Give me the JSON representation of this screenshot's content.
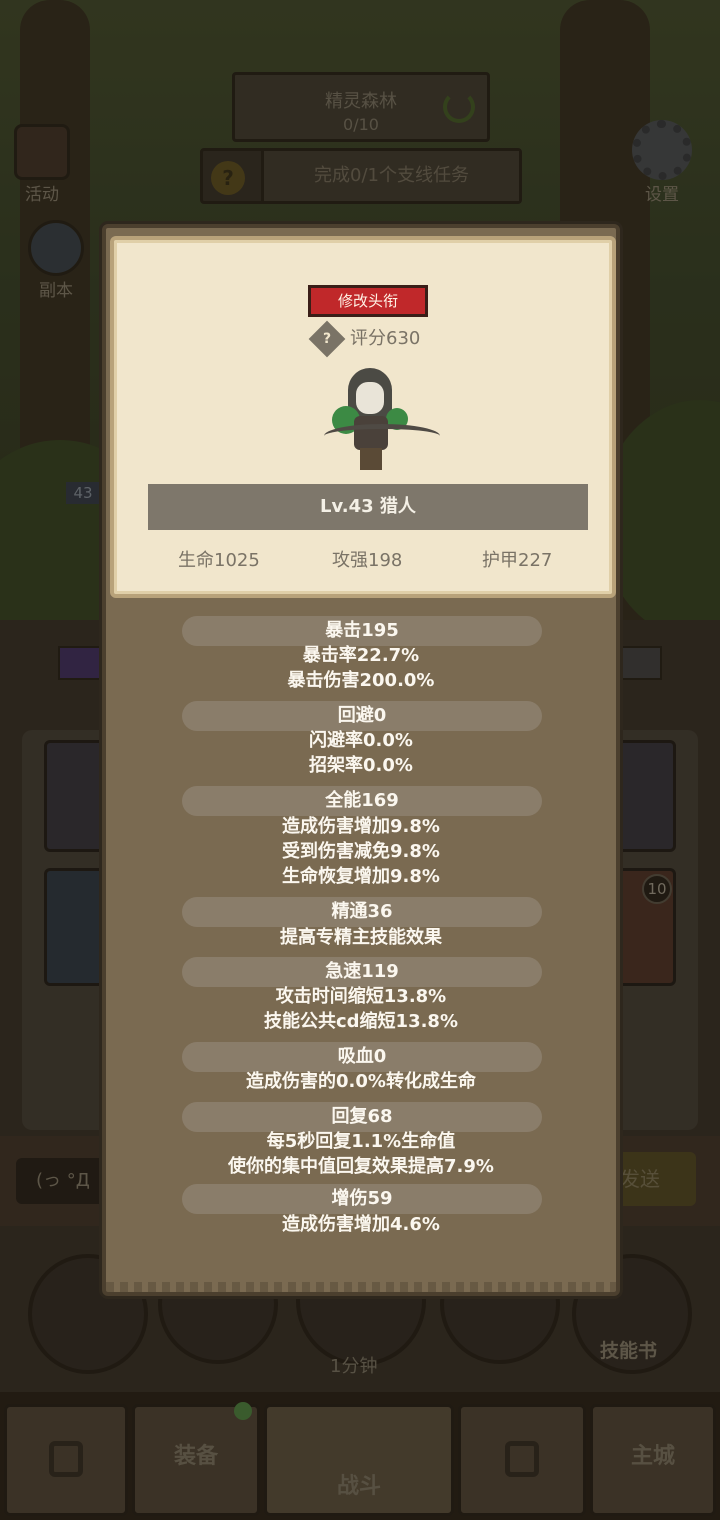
{
  "hud": {
    "map_name": "精灵森林",
    "map_progress": "0/10",
    "quest_text": "完成0/1个支线任务",
    "events_label": "活动",
    "dungeon_label": "副本",
    "settings_label": "设置",
    "side_level": "43",
    "slot_badge": "10",
    "chat_placeholder": "(っ °Д",
    "send_label": "发送",
    "timer": "1分钟",
    "skill_book": "技能书"
  },
  "nav": {
    "equipment": "装备",
    "battle": "战斗",
    "main_city": "主城"
  },
  "profile": {
    "title_button": "修改头衔",
    "score": "评分630",
    "level_class": "Lv.43 猎人",
    "hp": "生命1025",
    "attack": "攻强198",
    "armor": "护甲227"
  },
  "stats": {
    "crit": {
      "header": "暴击195",
      "lines": [
        "暴击率22.7%",
        "暴击伤害200.0%"
      ]
    },
    "dodge": {
      "header": "回避0",
      "lines": [
        "闪避率0.0%",
        "招架率0.0%"
      ]
    },
    "versatility": {
      "header": "全能169",
      "lines": [
        "造成伤害增加9.8%",
        "受到伤害减免9.8%",
        "生命恢复增加9.8%"
      ]
    },
    "mastery": {
      "header": "精通36",
      "lines": [
        "提高专精主技能效果"
      ]
    },
    "haste": {
      "header": "急速119",
      "lines": [
        "攻击时间缩短13.8%",
        "技能公共cd缩短13.8%"
      ]
    },
    "leech": {
      "header": "吸血0",
      "lines": [
        "造成伤害的0.0%转化成生命"
      ]
    },
    "regen": {
      "header": "回复68",
      "lines": [
        "每5秒回复1.1%生命值",
        "使你的集中值回复效果提高7.9%"
      ]
    },
    "damage_up": {
      "header": "增伤59",
      "lines": [
        "造成伤害增加4.6%"
      ]
    }
  },
  "colors": {
    "title_button": "#c0282a",
    "card_bg": "#f1e6cc",
    "modal_bg": "#7a6a51"
  }
}
